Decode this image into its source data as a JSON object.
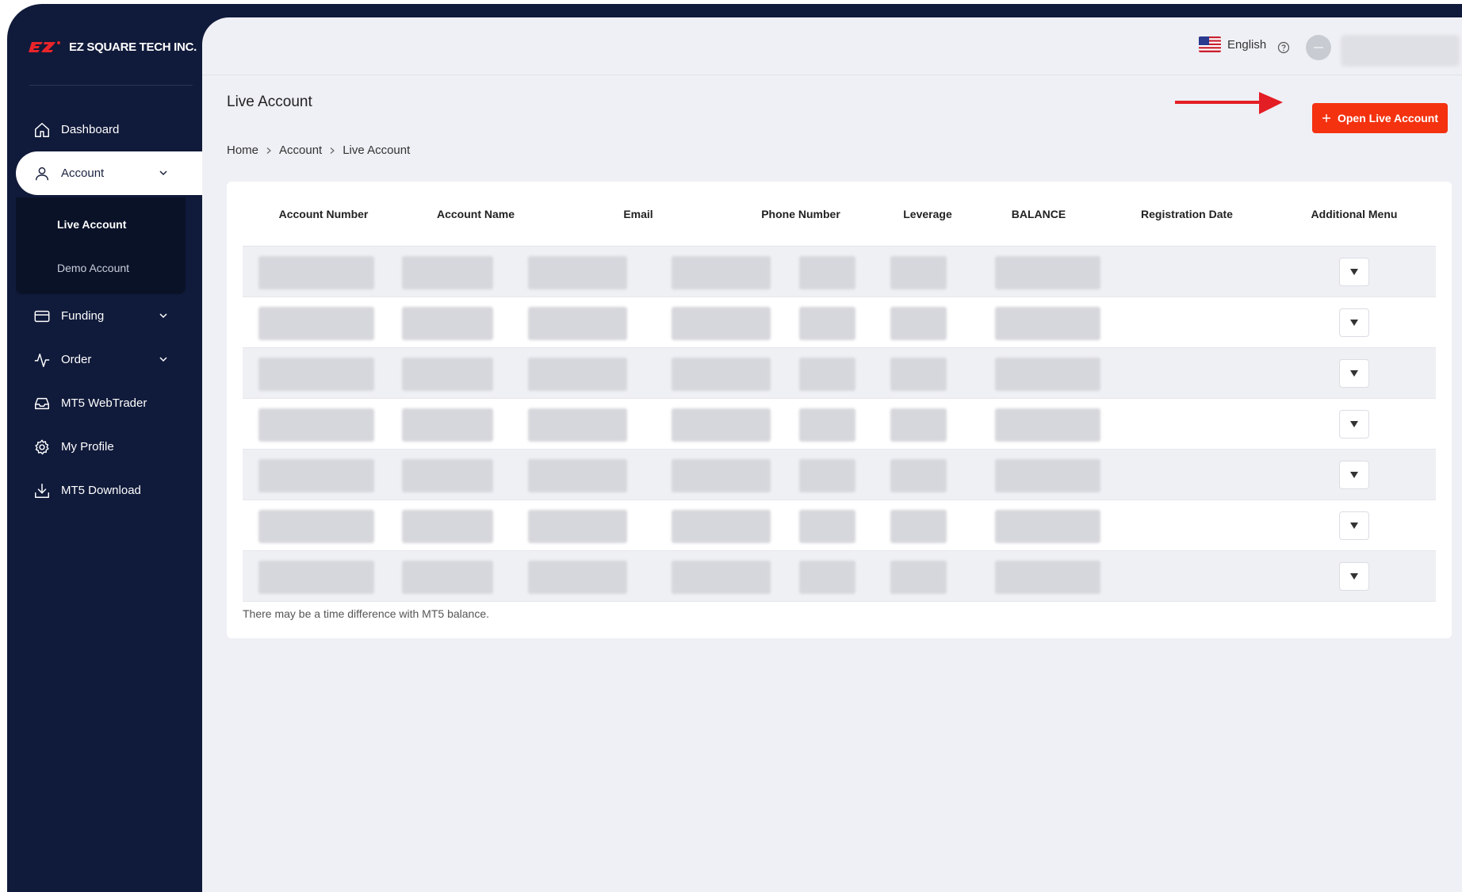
{
  "brand": {
    "name": "EZ SQUARE TECH INC.",
    "logo_mark": "EZ",
    "accent": "#f4320f"
  },
  "sidebar": {
    "items": [
      {
        "label": "Dashboard",
        "icon": "home-icon"
      },
      {
        "label": "Account",
        "icon": "user-icon",
        "expanded": true,
        "active": true,
        "children": [
          {
            "label": "Live Account",
            "active": true
          },
          {
            "label": "Demo Account"
          }
        ]
      },
      {
        "label": "Funding",
        "icon": "card-icon"
      },
      {
        "label": "Order",
        "icon": "activity-icon"
      },
      {
        "label": "MT5 WebTrader",
        "icon": "inbox-icon"
      },
      {
        "label": "My Profile",
        "icon": "gear-icon"
      },
      {
        "label": "MT5 Download",
        "icon": "download-icon"
      }
    ]
  },
  "header": {
    "language": "English",
    "flag": "us-flag-icon",
    "help_icon": "help-icon"
  },
  "page": {
    "title": "Live Account",
    "open_button": "Open Live Account",
    "breadcrumb": [
      "Home",
      "Account",
      "Live Account"
    ]
  },
  "table": {
    "columns": [
      "Account Number",
      "Account Name",
      "Email",
      "Phone Number",
      "Leverage",
      "BALANCE",
      "Registration Date",
      "Additional Menu"
    ],
    "row_count": 7
  },
  "note": "There may be a time difference with MT5 balance."
}
